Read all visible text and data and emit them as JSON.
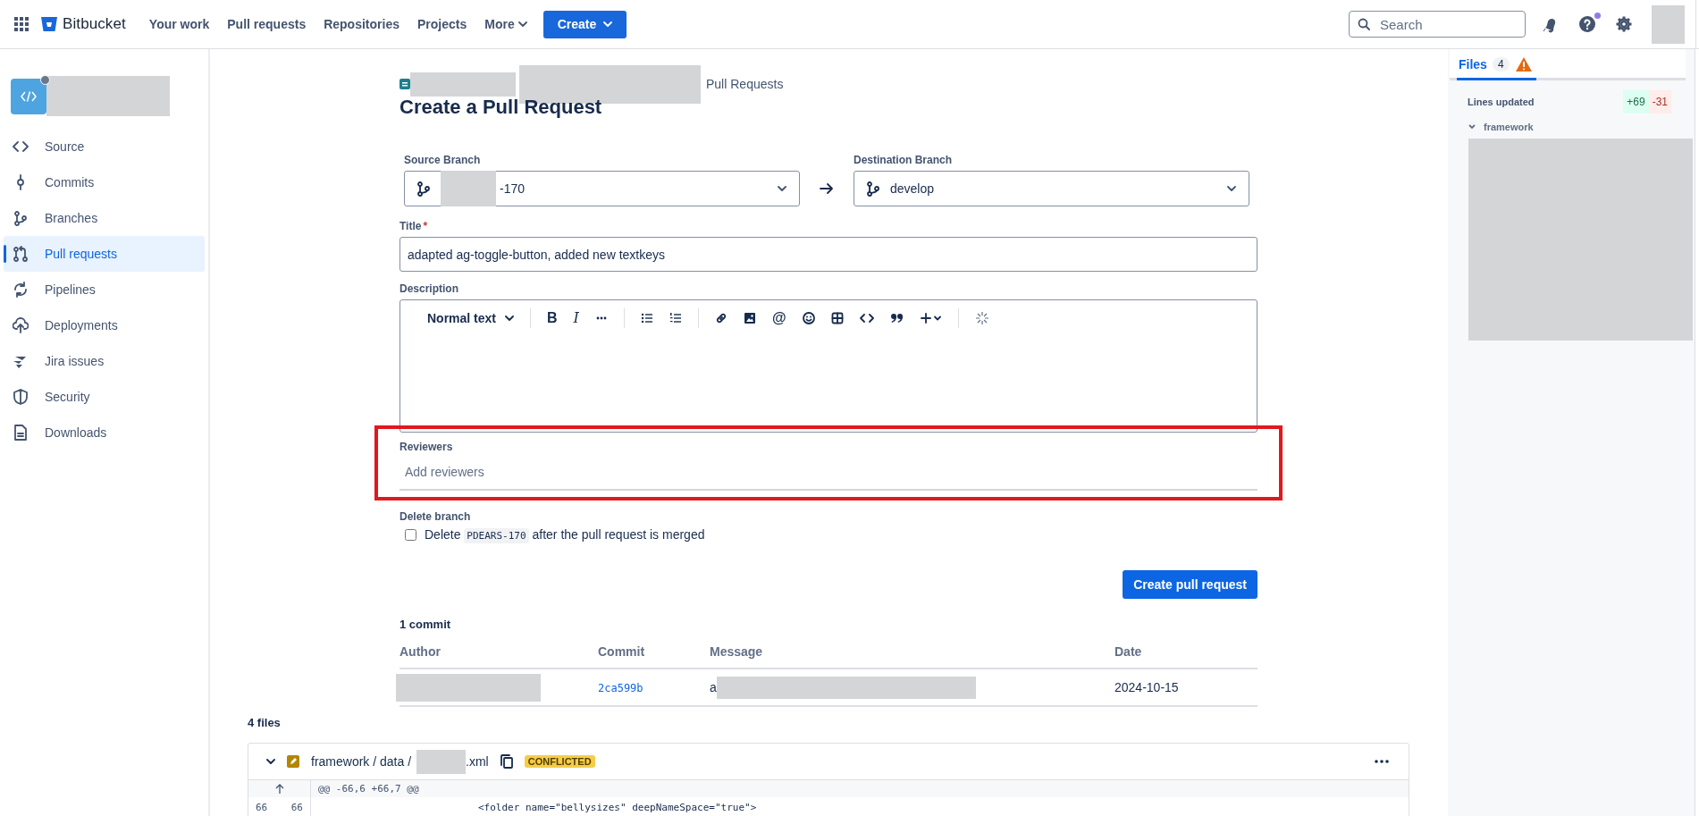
{
  "nav": {
    "product": "Bitbucket",
    "links": [
      "Your work",
      "Pull requests",
      "Repositories",
      "Projects"
    ],
    "more": "More",
    "create": "Create",
    "search": {
      "placeholder": "Search"
    },
    "help_has_update": true
  },
  "sidebar": {
    "items": [
      {
        "label": "Source",
        "selected": false
      },
      {
        "label": "Commits",
        "selected": false
      },
      {
        "label": "Branches",
        "selected": false
      },
      {
        "label": "Pull requests",
        "selected": true
      },
      {
        "label": "Pipelines",
        "selected": false
      },
      {
        "label": "Deployments",
        "selected": false
      },
      {
        "label": "Jira issues",
        "selected": false
      },
      {
        "label": "Security",
        "selected": false
      },
      {
        "label": "Downloads",
        "selected": false
      }
    ]
  },
  "breadcrumb": {
    "current": "Pull Requests"
  },
  "page_title": "Create a Pull Request",
  "form": {
    "source_branch": {
      "label": "Source Branch",
      "value_suffix": "-170"
    },
    "destination_branch": {
      "label": "Destination Branch",
      "value": "develop"
    },
    "title": {
      "label": "Title",
      "required_mark": "*",
      "value": "adapted ag-toggle-button, added new textkeys"
    },
    "description": {
      "label": "Description",
      "toolbar": {
        "text_style": "Normal text",
        "bold": "B",
        "italic": "I",
        "mention": "@"
      }
    },
    "reviewers": {
      "label": "Reviewers",
      "placeholder": "Add reviewers",
      "highlighted": true
    },
    "delete_branch": {
      "label": "Delete branch",
      "checked": false,
      "text_before": "Delete",
      "branch": "PDEARS-170",
      "text_after": "after the pull request is merged"
    },
    "submit": "Create pull request"
  },
  "commits": {
    "heading": "1 commit",
    "columns": [
      "Author",
      "Commit",
      "Message",
      "Date"
    ],
    "rows": [
      {
        "commit": "2ca599b",
        "message": "a",
        "date": "2024-10-15"
      }
    ]
  },
  "files": {
    "heading": "4 files",
    "file": {
      "expanded": true,
      "path": "framework / data /",
      "name_suffix": ".xml",
      "status": "CONFLICTED",
      "hunk": "@@ -66,6 +66,7 @@",
      "lines": [
        {
          "old": "66",
          "new": "66",
          "code": "<folder name=\"bellysizes\" deepNameSpace=\"true\">"
        }
      ]
    }
  },
  "side_panel": {
    "tab": {
      "label": "Files",
      "count": "4",
      "selected": true,
      "warning": true
    },
    "lines_updated": {
      "label": "Lines updated",
      "added": "+69",
      "removed": "-31"
    },
    "folder": {
      "name": "framework",
      "expanded": true
    }
  }
}
